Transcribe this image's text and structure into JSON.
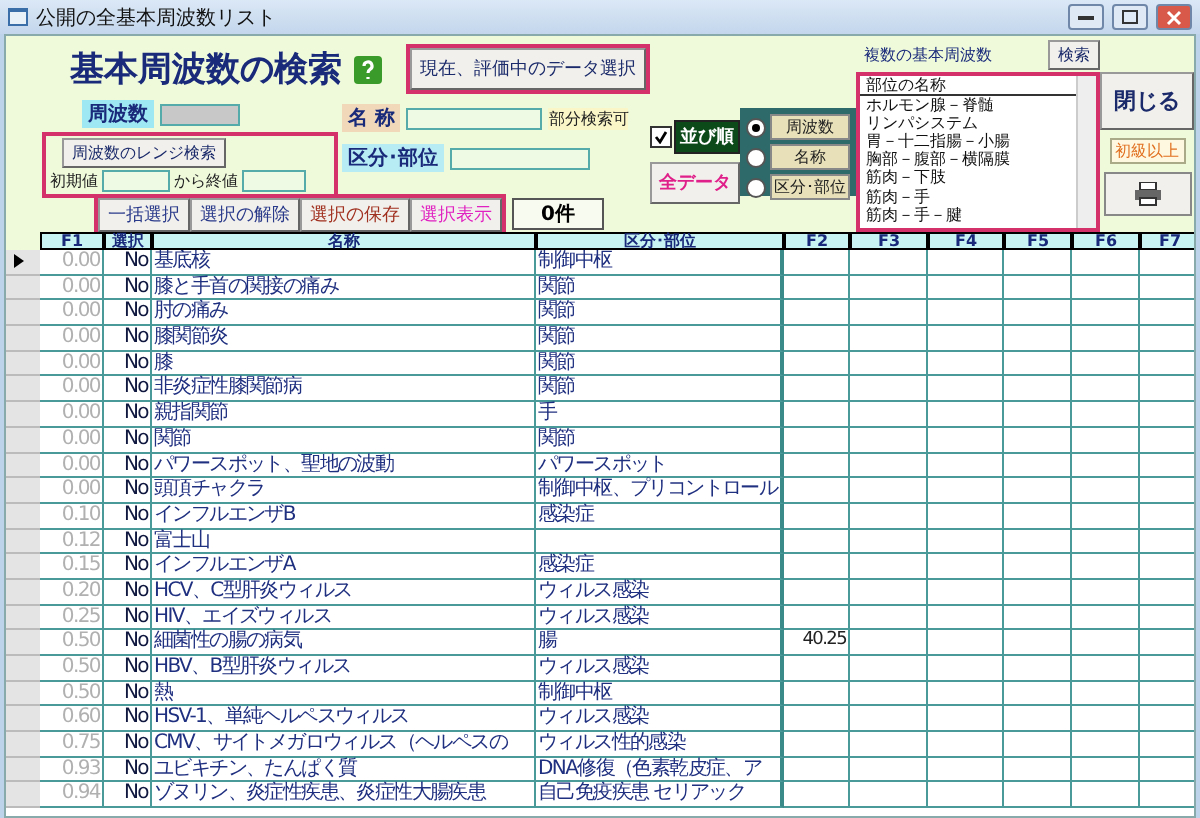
{
  "window": {
    "title": "公開の全基本周波数リスト"
  },
  "form": {
    "title": "基本周波数の検索",
    "data_select_button": "現在、評価中のデータ選択",
    "frequency_label": "周波数",
    "range_search_button": "周波数のレンジ検索",
    "start_label": "初期値",
    "end_label": "から終値",
    "name_label": "名 称",
    "partial_search_note": "部分検索可",
    "category_label": "区分･部位",
    "sort_checkbox": {
      "checked": true
    },
    "sort_button": "並び順",
    "all_data_button": "全データ",
    "sort_options": [
      {
        "label": "周波数",
        "selected": true
      },
      {
        "label": "名称",
        "selected": false
      },
      {
        "label": "区分･部位",
        "selected": false
      }
    ],
    "actions": [
      {
        "label": "一括選択",
        "color": "#2a3a8a"
      },
      {
        "label": "選択の解除",
        "color": "#2a3a8a"
      },
      {
        "label": "選択の保存",
        "color": "#a03020"
      },
      {
        "label": "選択表示",
        "color": "#e020c0"
      }
    ],
    "count": "0件",
    "multi": {
      "label": "複数の基本周波数",
      "search_button": "検索",
      "list_header": "部位の名称",
      "items": [
        "ホルモン腺－脊髄",
        "リンパシステム",
        "胃－十二指腸－小腸",
        "胸部－腹部－横隔膜",
        "筋肉－下肢",
        "筋肉－手",
        "筋肉－手－腱"
      ]
    },
    "close_button": "閉じる",
    "level_badge": "初級以上"
  },
  "table": {
    "columns": [
      "F1",
      "選択",
      "名称",
      "区分･部位",
      "F2",
      "F3",
      "F4",
      "F5",
      "F6",
      "F7"
    ],
    "rows": [
      {
        "f1": "0.00",
        "select": "No",
        "name": "基底核",
        "category": "制御中枢",
        "current": true
      },
      {
        "f1": "0.00",
        "select": "No",
        "name": "膝と手首の関接の痛み",
        "category": "関節",
        "current": false
      },
      {
        "f1": "0.00",
        "select": "No",
        "name": "肘の痛み",
        "category": "関節",
        "current": false
      },
      {
        "f1": "0.00",
        "select": "No",
        "name": "膝関節炎",
        "category": "関節",
        "current": false
      },
      {
        "f1": "0.00",
        "select": "No",
        "name": "膝",
        "category": "関節",
        "current": false
      },
      {
        "f1": "0.00",
        "select": "No",
        "name": "非炎症性膝関節病",
        "category": "関節",
        "current": false
      },
      {
        "f1": "0.00",
        "select": "No",
        "name": "親指関節",
        "category": "手",
        "current": false
      },
      {
        "f1": "0.00",
        "select": "No",
        "name": "関節",
        "category": "関節",
        "current": false
      },
      {
        "f1": "0.00",
        "select": "No",
        "name": "パワースポット、聖地の波動",
        "category": "パワースポット",
        "current": false
      },
      {
        "f1": "0.00",
        "select": "No",
        "name": "頭頂チャクラ",
        "category": "制御中枢、プリコントロール",
        "current": false
      },
      {
        "f1": "0.10",
        "select": "No",
        "name": "インフルエンザB",
        "category": "感染症",
        "current": false
      },
      {
        "f1": "0.12",
        "select": "No",
        "name": "富士山",
        "current": false
      },
      {
        "f1": "0.15",
        "select": "No",
        "name": "インフルエンザA",
        "category": "感染症",
        "current": false
      },
      {
        "f1": "0.20",
        "select": "No",
        "name": "HCV、C型肝炎ウィルス",
        "category": "ウィルス感染",
        "current": false
      },
      {
        "f1": "0.25",
        "select": "No",
        "name": "HIV、エイズウィルス",
        "category": "ウィルス感染",
        "current": false
      },
      {
        "f1": "0.50",
        "select": "No",
        "name": "細菌性の腸の病気",
        "category": "腸",
        "f2": "40.25",
        "current": false
      },
      {
        "f1": "0.50",
        "select": "No",
        "name": "HBV、B型肝炎ウィルス",
        "category": "ウィルス感染",
        "current": false
      },
      {
        "f1": "0.50",
        "select": "No",
        "name": "熱",
        "category": "制御中枢",
        "current": false
      },
      {
        "f1": "0.60",
        "select": "No",
        "name": "HSV-1、単純ヘルペスウィルス",
        "category": "ウィルス感染",
        "current": false
      },
      {
        "f1": "0.75",
        "select": "No",
        "name": "CMV、サイトメガロウィルス（ヘルペスの",
        "category": "ウィルス性的感染",
        "current": false
      },
      {
        "f1": "0.93",
        "select": "No",
        "name": "ユビキチン、たんぱく質",
        "category": "DNA修復（色素乾皮症、ア",
        "current": false
      },
      {
        "f1": "0.94",
        "select": "No",
        "name": "ゾヌリン、炎症性疾患、炎症性大腸疾患",
        "category": "自己免疫疾患 セリアック",
        "current": false
      }
    ]
  }
}
